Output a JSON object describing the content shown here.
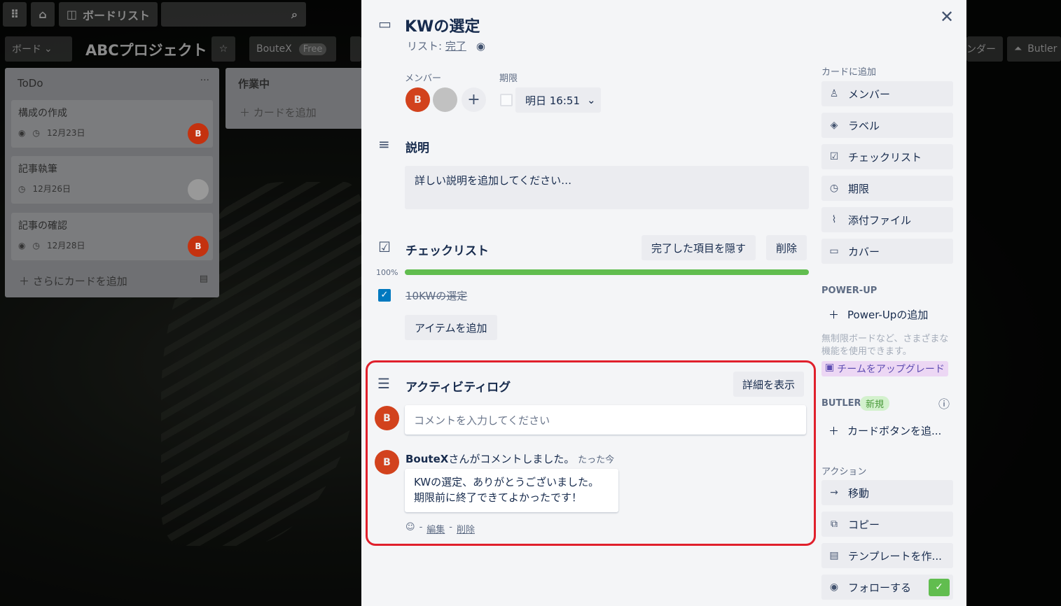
{
  "topbar": {
    "apps_icon": "grid-icon",
    "home_icon": "home-icon",
    "boards_label": "ボードリスト",
    "search_icon": "search-icon"
  },
  "board": {
    "view_label": "ボード",
    "title": "ABCプロジェクト",
    "workspace": "BouteX",
    "plan_badge": "Free",
    "right_partial": "ンダー",
    "butler_label": "Butler"
  },
  "lists": [
    {
      "title": "ToDo",
      "menu": "···",
      "cards": [
        {
          "title": "構成の作成",
          "watch": true,
          "due": "12月23日",
          "member": "B"
        },
        {
          "title": "記事執筆",
          "watch": false,
          "due": "12月26日",
          "member": ""
        },
        {
          "title": "記事の確認",
          "watch": true,
          "due": "12月28日",
          "member": "B"
        }
      ],
      "add_label": "さらにカードを追加"
    },
    {
      "title": "作業中",
      "cards": [],
      "add_label": "カードを追加"
    }
  ],
  "card_detail": {
    "title": "KWの選定",
    "list_prefix": "リスト:",
    "list_name": "完了",
    "members_label": "メンバー",
    "member_initial": "B",
    "due_label": "期限",
    "due_value": "明日 16:51",
    "description": {
      "heading": "説明",
      "placeholder": "詳しい説明を追加してください…"
    },
    "checklist": {
      "heading": "チェックリスト",
      "hide_label": "完了した項目を隠す",
      "delete_label": "削除",
      "progress_text": "100%",
      "progress": 100,
      "items": [
        {
          "text": "10KWの選定",
          "checked": true
        }
      ],
      "add_item_label": "アイテムを追加"
    },
    "activity": {
      "heading": "アクティビティログ",
      "details_label": "詳細を表示",
      "comment_placeholder": "コメントを入力してください",
      "entry": {
        "author": "BouteX",
        "action": "さんがコメントしました。",
        "time": "たった今",
        "line1": "KWの選定、ありがとうございました。",
        "line2": "期限前に終了できてよかったです！",
        "sep": "-",
        "edit": "編集",
        "delete": "削除"
      }
    },
    "close_icon": "close-icon"
  },
  "sidebar": {
    "add_heading": "カードに追加",
    "add_items": [
      {
        "label": "メンバー",
        "icon": "person-icon"
      },
      {
        "label": "ラベル",
        "icon": "tag-icon"
      },
      {
        "label": "チェックリスト",
        "icon": "checkbox-icon"
      },
      {
        "label": "期限",
        "icon": "clock-icon"
      },
      {
        "label": "添付ファイル",
        "icon": "paperclip-icon"
      },
      {
        "label": "カバー",
        "icon": "cover-icon"
      }
    ],
    "powerup_heading": "POWER-UP",
    "powerup_add": "Power-Upの追加",
    "powerup_note_1": "無制限ボードなど、さまざまな",
    "powerup_note_2": "機能を使用できます。",
    "upgrade_label": "チームをアップグレード",
    "butler_heading": "BUTLER",
    "butler_badge": "新規",
    "butler_add": "カードボタンを追...",
    "actions_heading": "アクション",
    "actions": [
      {
        "label": "移動",
        "icon": "arrow-right-icon"
      },
      {
        "label": "コピー",
        "icon": "copy-icon"
      },
      {
        "label": "テンプレートを作...",
        "icon": "template-icon"
      },
      {
        "label": "フォローする",
        "icon": "eye-icon"
      }
    ]
  },
  "colors": {
    "accent_red": "#c9372c",
    "highlight_border": "#e0202c",
    "progress_green": "#61bd4f",
    "checkbox_blue": "#0079bf"
  }
}
